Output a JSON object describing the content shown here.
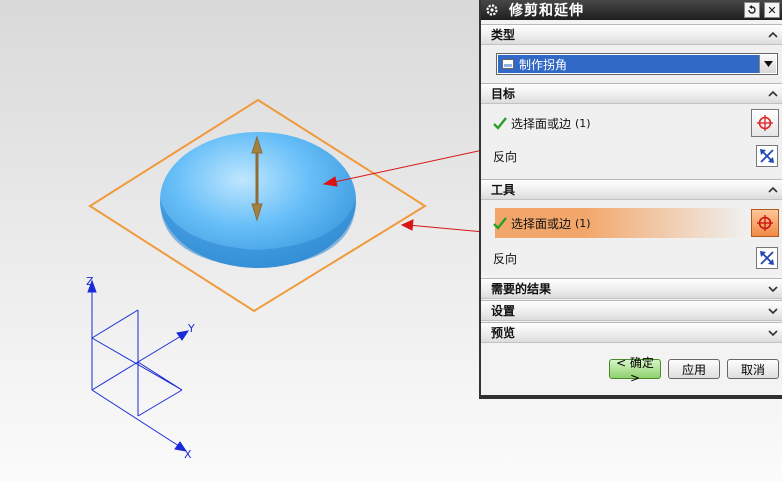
{
  "dialog": {
    "title": "修剪和延伸",
    "close_glyph": "✕",
    "sections": {
      "type": {
        "label": "类型",
        "selected": "制作拐角"
      },
      "target": {
        "label": "目标",
        "select_label": "选择面或边",
        "select_count": "(1)",
        "reverse_label": "反向"
      },
      "tool": {
        "label": "工具",
        "select_label": "选择面或边",
        "select_count": "(1)",
        "reverse_label": "反向"
      },
      "result": {
        "label": "需要的结果"
      },
      "settings": {
        "label": "设置"
      },
      "preview": {
        "label": "预览"
      }
    },
    "buttons": {
      "ok": "< 确定 >",
      "apply": "应用",
      "cancel": "取消"
    }
  },
  "axes": {
    "z": "Z",
    "y": "Y",
    "x": "X"
  },
  "colors": {
    "plane": "#f09a3c",
    "dome": "#5ab8f5",
    "arrow": "#9a7a40",
    "axes": "#1a2ad8",
    "leader": "#d81414",
    "active_row": "#f2a66a"
  }
}
